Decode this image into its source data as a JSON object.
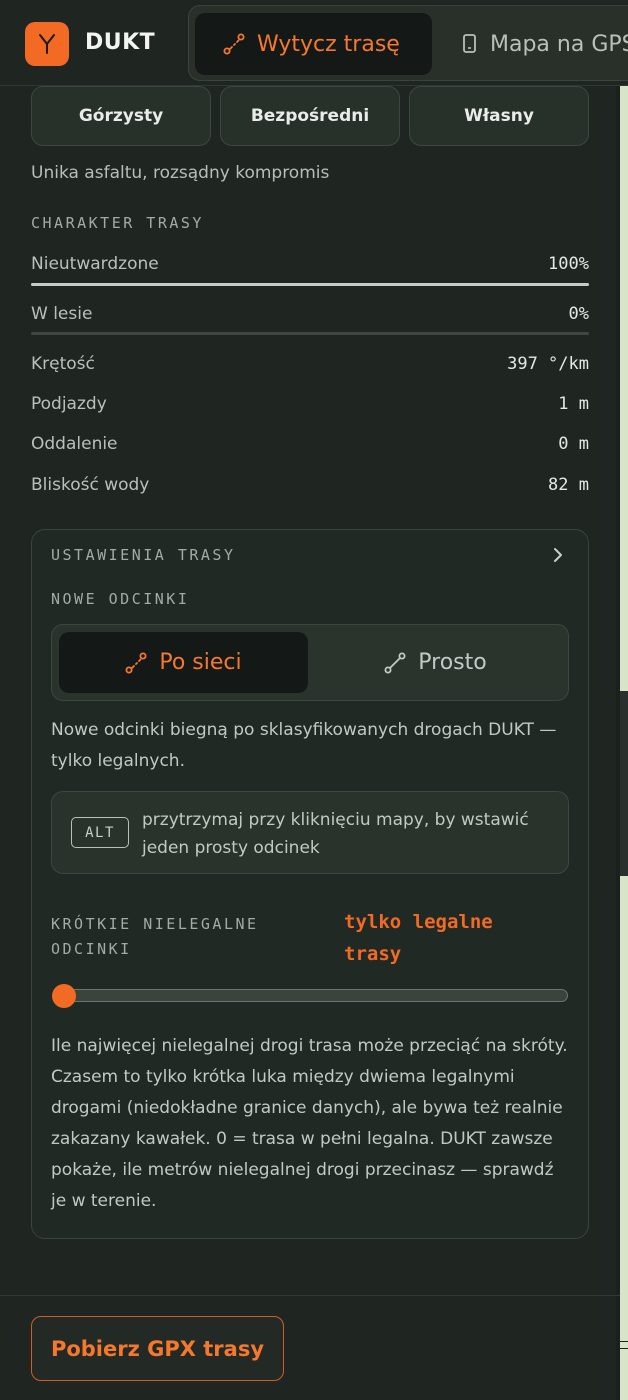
{
  "header": {
    "logo_letter": "Y",
    "app_name": "DUKT",
    "tabs": [
      {
        "label": "Wytycz trasę",
        "icon": "route-icon",
        "active": true
      },
      {
        "label": "Mapa na GPS",
        "icon": "phone-icon",
        "active": false
      }
    ]
  },
  "profile": {
    "modes": [
      {
        "label": "Górzysty"
      },
      {
        "label": "Bezpośredni"
      },
      {
        "label": "Własny"
      }
    ],
    "description": "Unika asfaltu, rozsądny kompromis"
  },
  "character": {
    "title": "CHARAKTER TRASY",
    "unpaved": {
      "label": "Nieutwardzone",
      "value": "100%",
      "fraction": 1.0
    },
    "forest": {
      "label": "W lesie",
      "value": "0%",
      "fraction": 0.0
    },
    "stats": [
      {
        "label": "Krętość",
        "value": "397 °/km"
      },
      {
        "label": "Podjazdy",
        "value": "1 m"
      },
      {
        "label": "Oddalenie",
        "value": "0 m"
      },
      {
        "label": "Bliskość wody",
        "value": "82 m"
      }
    ]
  },
  "settings": {
    "title": "USTAWIENIA TRASY",
    "new_segments_title": "NOWE ODCINKI",
    "segment_modes": [
      {
        "label": "Po sieci",
        "active": true
      },
      {
        "label": "Prosto",
        "active": false
      }
    ],
    "network_desc": "Nowe odcinki biegną po sklasyfikowanych drogach DUKT — tylko legalnych.",
    "tip_key": "ALT",
    "tip_text": "przytrzymaj przy kliknięciu mapy, by wstawić jeden prosty odcinek",
    "illegal_title": "KRÓTKIE NIELEGALNE ODCINKI",
    "illegal_value": "tylko legalne trasy",
    "illegal_slider_fraction": 0.0,
    "illegal_desc": "Ile najwięcej nielegalnej drogi trasa może przeciąć na skróty. Czasem to tylko krótka luka między dwiema legalnymi drogami (niedokładne granice danych), ale bywa też realnie zakazany kawałek. 0 = trasa w pełni legalna. DUKT zawsze pokaże, ile metrów nielegalnej drogi przecinasz — sprawdź je w terenie."
  },
  "footer": {
    "download_label": "Pobierz GPX trasy"
  },
  "colors": {
    "accent": "#f26a23",
    "background": "#1f2621",
    "card": "#212924"
  }
}
